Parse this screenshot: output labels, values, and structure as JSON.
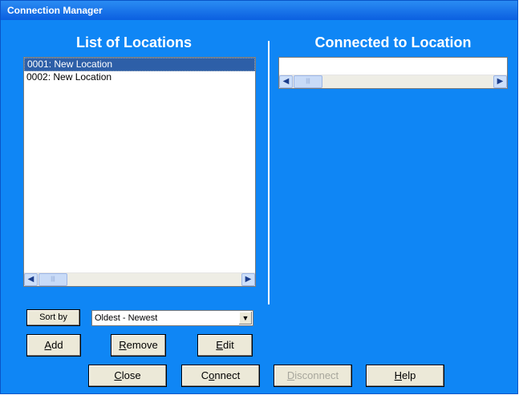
{
  "window": {
    "title": "Connection Manager"
  },
  "locations": {
    "heading": "List of Locations",
    "items": [
      {
        "label": "0001: New Location",
        "selected": true
      },
      {
        "label": "0002: New Location",
        "selected": false
      }
    ]
  },
  "connected": {
    "heading": "Connected to Location"
  },
  "sort": {
    "button_label": "Sort by",
    "selected_option": "Oldest - Newest"
  },
  "actions": {
    "add": {
      "pre": "",
      "key": "A",
      "post": "dd"
    },
    "remove": {
      "pre": "",
      "key": "R",
      "post": "emove"
    },
    "edit": {
      "pre": "",
      "key": "E",
      "post": "dit"
    },
    "close": {
      "pre": "",
      "key": "C",
      "post": "lose"
    },
    "connect": {
      "pre": "C",
      "key": "o",
      "post": "nnect"
    },
    "disconnect": {
      "pre": "",
      "key": "D",
      "post": "isconnect",
      "enabled": false
    },
    "help": {
      "pre": "",
      "key": "H",
      "post": "elp"
    }
  },
  "icons": {
    "scroll_left": "◀",
    "scroll_right": "▶",
    "dropdown": "▼",
    "grip": "|||"
  },
  "colors": {
    "background": "#0f86f5",
    "selection": "#2d5fa8",
    "button_face": "#ece9d8"
  }
}
